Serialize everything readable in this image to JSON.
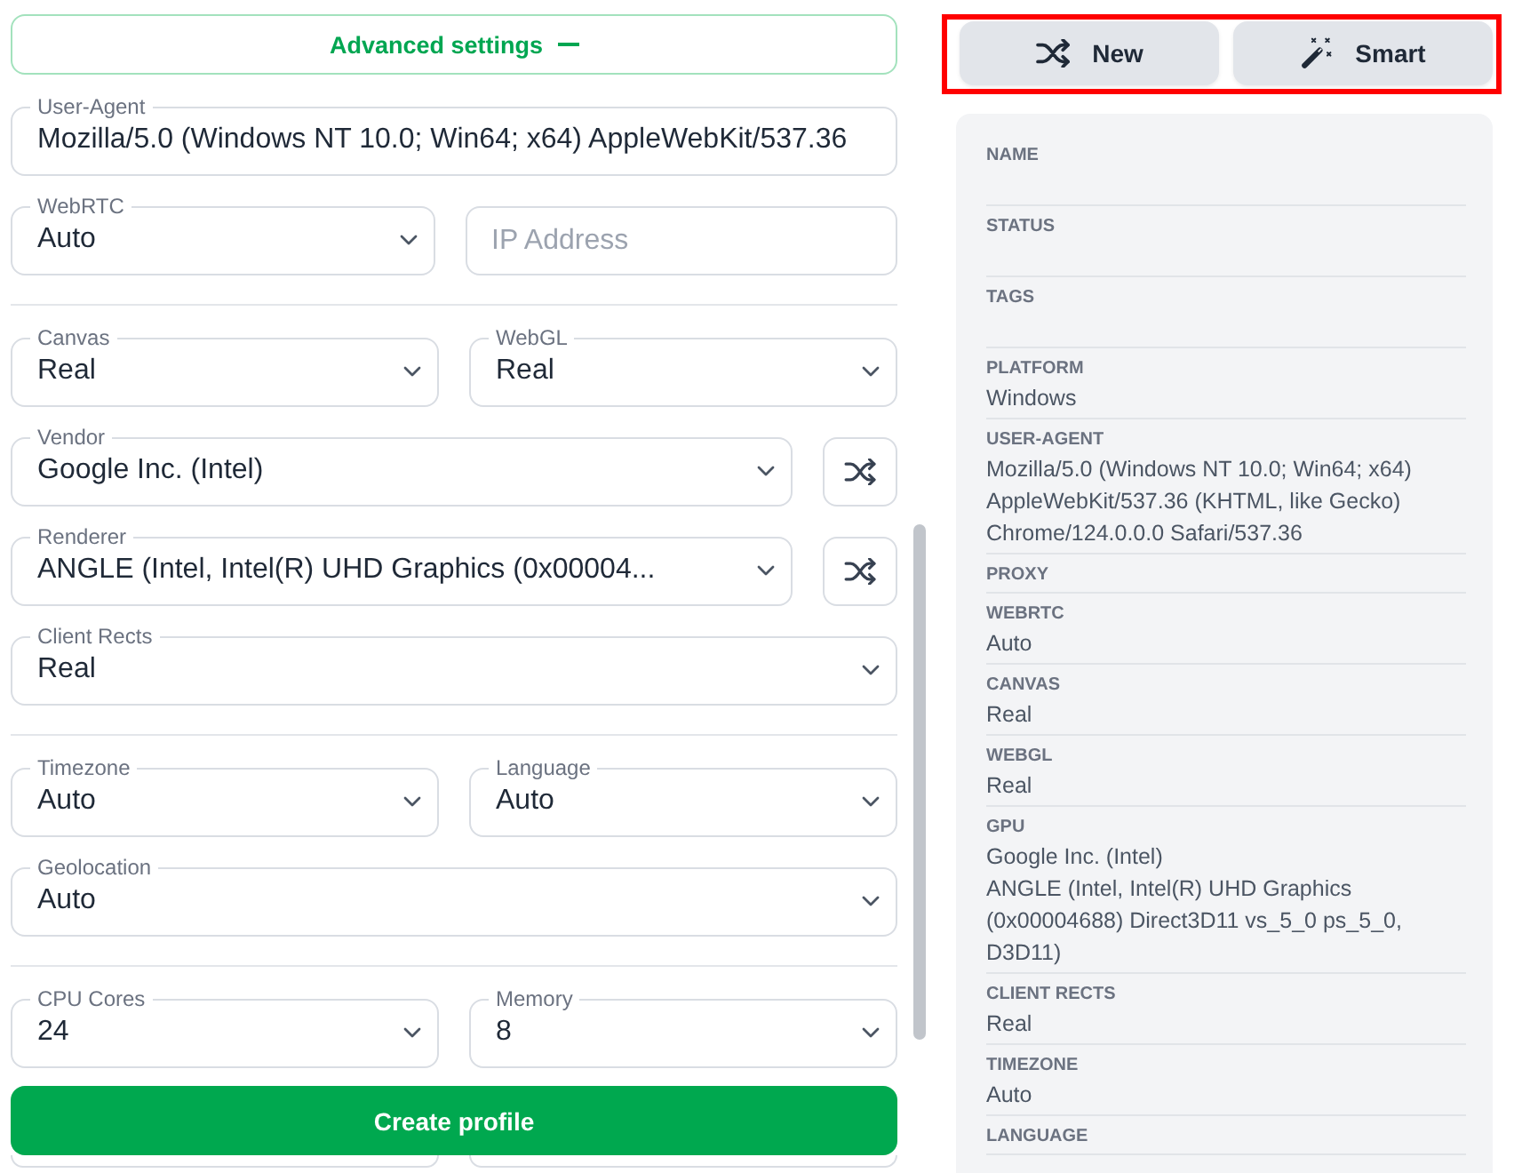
{
  "advanced_toggle": {
    "label": "Advanced settings",
    "expanded": true
  },
  "form": {
    "rows": [
      {
        "kind": "fields",
        "items": [
          {
            "kind": "text-field",
            "label": "User-Agent",
            "value": "Mozilla/5.0 (Windows NT 10.0; Win64; x64) AppleWebKit/537.36"
          }
        ]
      },
      {
        "kind": "fields",
        "items": [
          {
            "kind": "select",
            "label": "WebRTC",
            "value": "Auto"
          },
          {
            "kind": "input",
            "placeholder": "IP Address"
          }
        ]
      },
      {
        "kind": "divider"
      },
      {
        "kind": "fields",
        "items": [
          {
            "kind": "select",
            "label": "Canvas",
            "value": "Real"
          },
          {
            "kind": "select",
            "label": "WebGL",
            "value": "Real"
          }
        ]
      },
      {
        "kind": "fields",
        "items": [
          {
            "kind": "select",
            "label": "Vendor",
            "value": "Google Inc. (Intel)"
          },
          {
            "kind": "shuffle-button"
          }
        ]
      },
      {
        "kind": "fields",
        "items": [
          {
            "kind": "select",
            "label": "Renderer",
            "value": "ANGLE (Intel, Intel(R) UHD Graphics (0x00004..."
          },
          {
            "kind": "shuffle-button"
          }
        ]
      },
      {
        "kind": "fields",
        "items": [
          {
            "kind": "select",
            "label": "Client Rects",
            "value": "Real"
          }
        ]
      },
      {
        "kind": "divider"
      },
      {
        "kind": "fields",
        "items": [
          {
            "kind": "select",
            "label": "Timezone",
            "value": "Auto"
          },
          {
            "kind": "select",
            "label": "Language",
            "value": "Auto"
          }
        ]
      },
      {
        "kind": "fields",
        "items": [
          {
            "kind": "select",
            "label": "Geolocation",
            "value": "Auto"
          }
        ]
      },
      {
        "kind": "divider"
      },
      {
        "kind": "fields",
        "items": [
          {
            "kind": "select",
            "label": "CPU Cores",
            "value": "24"
          },
          {
            "kind": "select",
            "label": "Memory",
            "value": "8"
          }
        ]
      },
      {
        "kind": "covered",
        "items": [
          {
            "kind": "select"
          },
          {
            "kind": "select"
          }
        ]
      }
    ]
  },
  "create_button": {
    "label": "Create profile"
  },
  "actions": {
    "highlighted": true,
    "buttons": [
      {
        "kind": "shuffle",
        "label": "New"
      },
      {
        "kind": "wand",
        "label": "Smart"
      }
    ]
  },
  "summary": {
    "items": [
      {
        "kind": "empty",
        "label": "NAME"
      },
      {
        "kind": "empty",
        "label": "STATUS"
      },
      {
        "kind": "empty",
        "label": "TAGS"
      },
      {
        "kind": "value",
        "label": "PLATFORM",
        "values": [
          "Windows"
        ]
      },
      {
        "kind": "value",
        "label": "USER-AGENT",
        "values": [
          "Mozilla/5.0 (Windows NT 10.0; Win64; x64) AppleWebKit/537.36 (KHTML, like Gecko) Chrome/124.0.0.0 Safari/537.36"
        ]
      },
      {
        "kind": "bare",
        "label": "PROXY"
      },
      {
        "kind": "value",
        "label": "WEBRTC",
        "values": [
          "Auto"
        ]
      },
      {
        "kind": "value",
        "label": "CANVAS",
        "values": [
          "Real"
        ]
      },
      {
        "kind": "value",
        "label": "WEBGL",
        "values": [
          "Real"
        ]
      },
      {
        "kind": "value",
        "label": "GPU",
        "values": [
          "Google Inc. (Intel)",
          "ANGLE (Intel, Intel(R) UHD Graphics (0x00004688) Direct3D11 vs_5_0 ps_5_0, D3D11)"
        ]
      },
      {
        "kind": "value",
        "label": "CLIENT RECTS",
        "values": [
          "Real"
        ]
      },
      {
        "kind": "value",
        "label": "TIMEZONE",
        "values": [
          "Auto"
        ]
      },
      {
        "kind": "bare",
        "label": "LANGUAGE"
      }
    ]
  }
}
